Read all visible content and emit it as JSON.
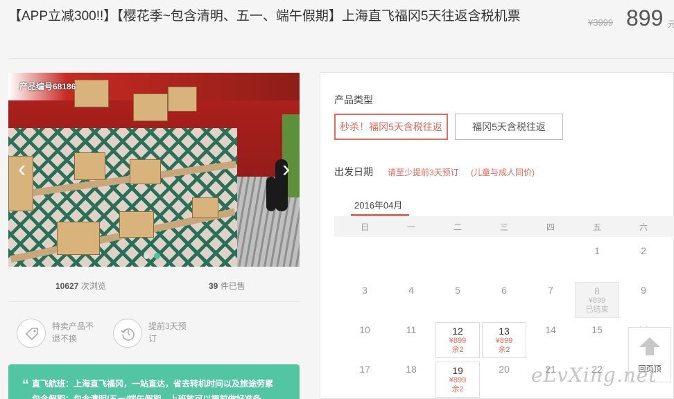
{
  "header": {
    "title": "【APP立减300!!】【樱花季~包含清明、五一、端午假期】上海直飞福冈5天往返含税机票",
    "old_price": "¥3999",
    "price": "899",
    "price_unit": "元"
  },
  "gallery": {
    "product_no": "产品编号68186",
    "prev_icon": "chevron-left-icon",
    "next_icon": "chevron-right-icon",
    "dot_count": 2,
    "active_dot": 1
  },
  "stats": {
    "views_count": "10627",
    "views_label": "次浏览",
    "sold_count": "39",
    "sold_label": "件已售"
  },
  "features": [
    {
      "icon": "tag-icon",
      "text_line1": "特卖产品不",
      "text_line2": "退不换"
    },
    {
      "icon": "clock-icon",
      "text_line1": "提前3天预",
      "text_line2": "订"
    }
  ],
  "notice": {
    "text_line1": "直飞航班：上海直飞福冈，一站直达，省去转机时间以及旅途劳累",
    "text_line2": "包含假期：包含清明/五一/端午假期，上班族可以提前做好准备"
  },
  "product_type": {
    "label": "产品类型",
    "options": [
      "秒杀！福冈5天含税往返",
      "福冈5天含税往返"
    ],
    "selected": 0
  },
  "departure": {
    "label": "出发日期",
    "hint1": "请至少提前3天预订",
    "hint2": "(儿童与成人同价)",
    "month": "2016年04月",
    "weekdays": [
      "日",
      "一",
      "二",
      "三",
      "四",
      "五",
      "六"
    ],
    "days": {
      "d1": "1",
      "d2": "2",
      "d3": "3",
      "d4": "4",
      "d5": "5",
      "d6": "6",
      "d7": "7",
      "d8": "8",
      "d8_price": "¥899",
      "d8_status": "已结束",
      "d9": "9",
      "d10": "10",
      "d11": "11",
      "d12": "12",
      "d12_price": "¥899",
      "d12_stock": "余2",
      "d13": "13",
      "d13_price": "¥899",
      "d13_stock": "余2",
      "d14": "14",
      "d15": "15",
      "d16": "16",
      "d17": "17",
      "d18": "18",
      "d19": "19",
      "d19_price": "¥899",
      "d19_stock": "余2",
      "d20": "20",
      "d21": "21",
      "d22": "22"
    }
  },
  "back_top": {
    "label": "回页顶",
    "icon": "arrow-up-icon"
  },
  "watermark": "eLvXing.net",
  "colors": {
    "accent": "#e86a5a",
    "green": "#52c5a2"
  }
}
